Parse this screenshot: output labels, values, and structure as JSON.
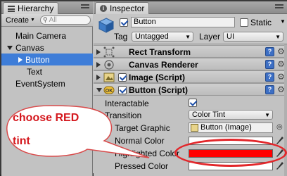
{
  "hierarchy": {
    "tab_label": "Hierarchy",
    "create_label": "Create",
    "search_placeholder": "All",
    "items": [
      {
        "label": "Main Camera"
      },
      {
        "label": "Canvas"
      },
      {
        "label": "Button"
      },
      {
        "label": "Text"
      },
      {
        "label": "EventSystem"
      }
    ]
  },
  "inspector": {
    "tab_label": "Inspector",
    "object_name": "Button",
    "static_label": "Static",
    "tag_label": "Tag",
    "tag_value": "Untagged",
    "layer_label": "Layer",
    "layer_value": "UI",
    "components": [
      {
        "name": "Rect Transform"
      },
      {
        "name": "Canvas Renderer"
      },
      {
        "name": "Image (Script)"
      },
      {
        "name": "Button (Script)"
      }
    ],
    "interactable_label": "Interactable",
    "transition_label": "Transition",
    "transition_value": "Color Tint",
    "target_graphic_label": "Target Graphic",
    "target_graphic_value": "Button (Image)",
    "normal_color_label": "Normal Color",
    "highlighted_color_label": "Highlighted Color",
    "pressed_color_label": "Pressed Color",
    "colors": {
      "normal": "#ffffff",
      "highlighted": "#ff0000",
      "pressed": "#ffffff"
    }
  },
  "annotation": {
    "line1": "choose RED",
    "line2": "tint",
    "color": "#e2262a"
  }
}
